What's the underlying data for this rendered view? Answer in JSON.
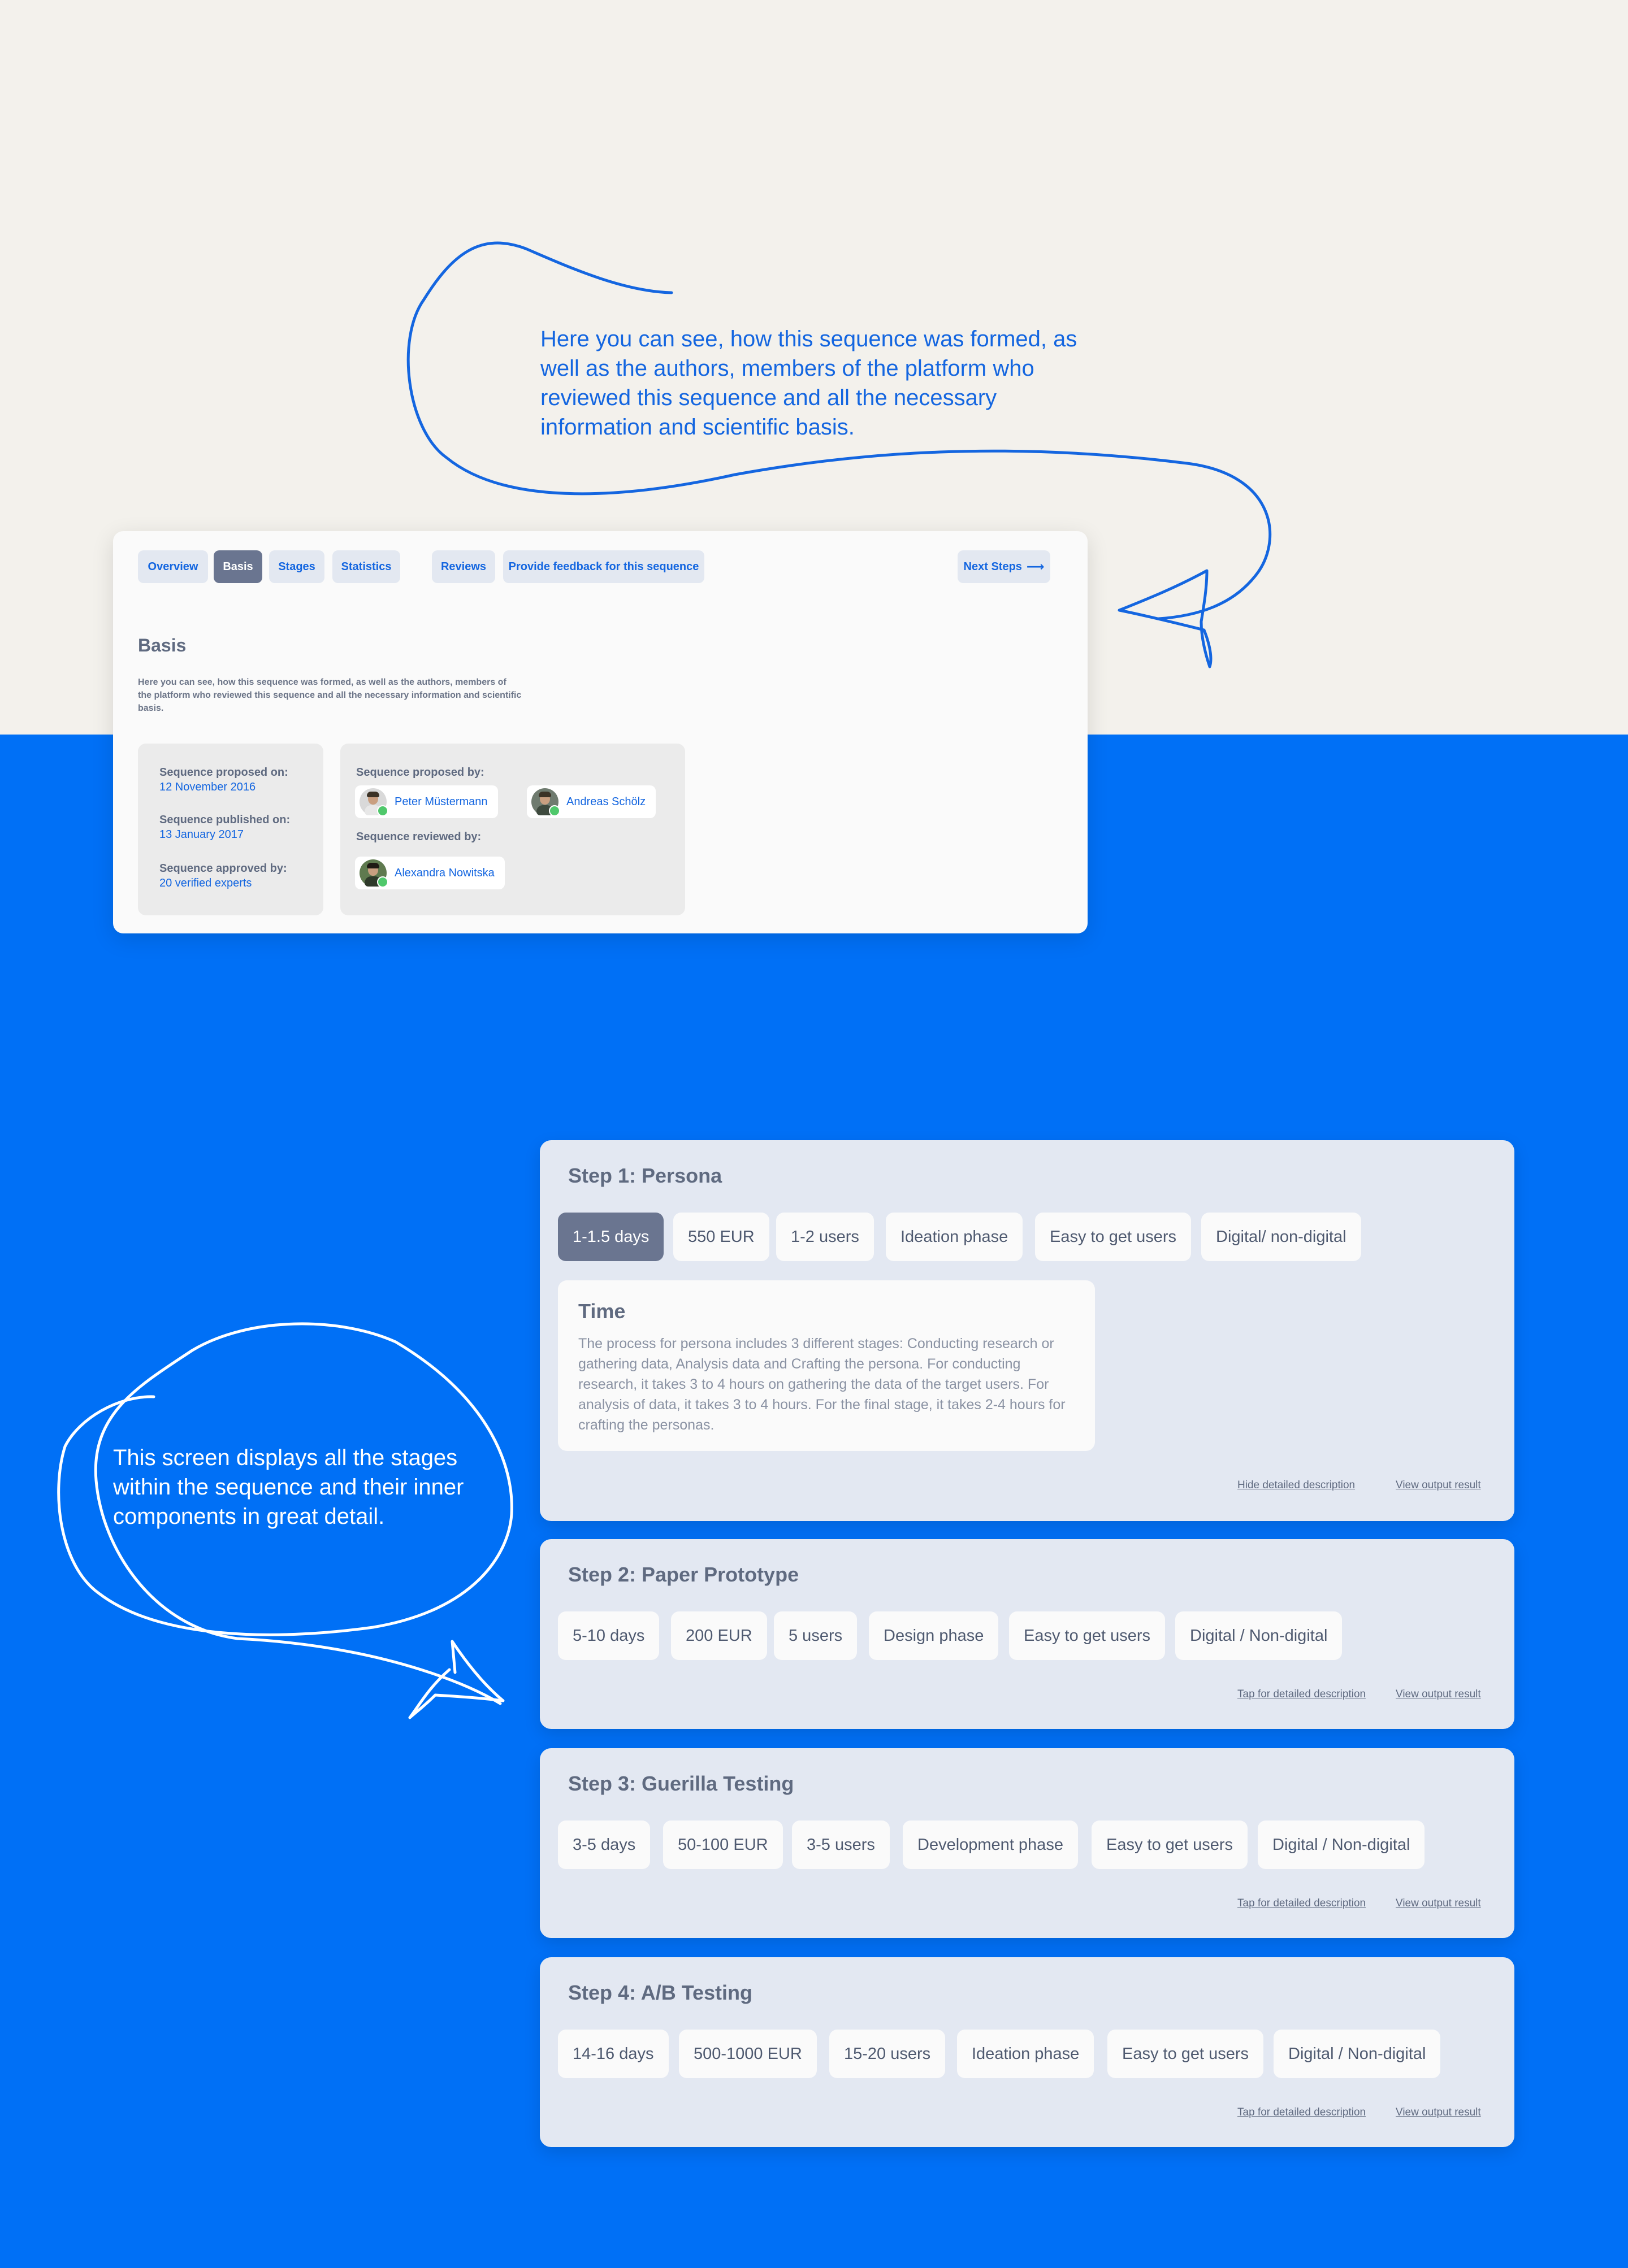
{
  "annotations": {
    "top": "Here you can see, how this sequence was formed, as well as the authors, members of the platform who reviewed this sequence and all the necessary information and scientific basis.",
    "bottom": "This screen displays all the stages within the sequence and their inner components in great detail."
  },
  "basis": {
    "tabs": [
      "Overview",
      "Basis",
      "Stages",
      "Statistics",
      "Reviews",
      "Provide feedback for this sequence"
    ],
    "active_tab": "Basis",
    "next_steps": "Next Steps",
    "title": "Basis",
    "description": "Here you can see, how this sequence was formed, as well as the authors, members of the platform who reviewed this sequence and all the necessary information and scientific basis.",
    "dates": [
      {
        "label": "Sequence proposed on:",
        "value": "12 November 2016"
      },
      {
        "label": "Sequence published on:",
        "value": "13 January 2017"
      },
      {
        "label": "Sequence approved by:",
        "value": "20 verified experts"
      }
    ],
    "proposed_by_label": "Sequence proposed by:",
    "proposed_by": [
      "Peter Müstermann",
      "Andreas Schölz"
    ],
    "reviewed_by_label": "Sequence reviewed by:",
    "reviewed_by": [
      "Alexandra Nowitska"
    ]
  },
  "steps": [
    {
      "title": "Step 1: Persona",
      "tags": [
        "1-1.5 days",
        "550 EUR",
        "1-2 users",
        "Ideation phase",
        "Easy to get users",
        "Digital/ non-digital"
      ],
      "active_tag": "1-1.5 days",
      "detail": {
        "title": "Time",
        "text": "The process for persona includes 3 different stages: Conducting research or gathering data, Analysis data and Crafting the persona. For conducting research, it takes 3 to 4 hours on gathering the data of the target users. For analysis of data, it takes 3 to 4 hours. For the final stage, it takes 2-4 hours for crafting the personas."
      },
      "desc_link": "Hide detailed description",
      "output_link": "View output result"
    },
    {
      "title": "Step 2: Paper Prototype",
      "tags": [
        "5-10 days",
        "200 EUR",
        "5 users",
        "Design phase",
        "Easy to get users",
        "Digital / Non-digital"
      ],
      "desc_link": "Tap for detailed description",
      "output_link": "View output result"
    },
    {
      "title": "Step 3: Guerilla Testing",
      "tags": [
        "3-5 days",
        "50-100 EUR",
        "3-5 users",
        "Development phase",
        "Easy to get users",
        "Digital / Non-digital"
      ],
      "desc_link": "Tap for detailed description",
      "output_link": "View output result"
    },
    {
      "title": "Step 4: A/B Testing",
      "tags": [
        "14-16 days",
        "500-1000 EUR",
        "15-20 users",
        "Ideation phase",
        "Easy to get users",
        "Digital / Non-digital"
      ],
      "desc_link": "Tap for detailed description",
      "output_link": "View output result"
    }
  ]
}
